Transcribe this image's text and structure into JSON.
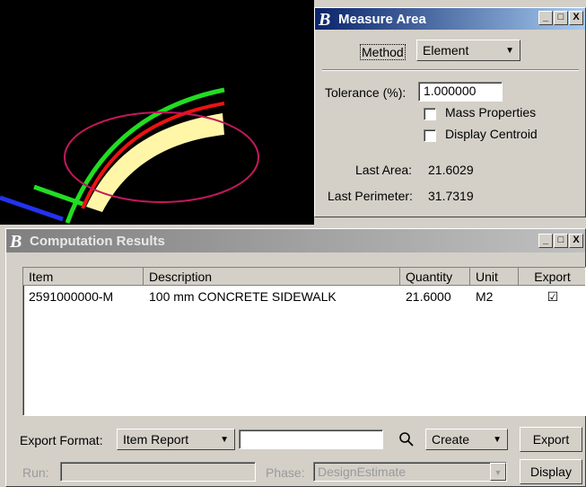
{
  "measure_area": {
    "title": "Measure Area",
    "method_label": "Method",
    "method_value": "Element",
    "tolerance_label": "Tolerance (%):",
    "tolerance_value": "1.000000",
    "mass_properties_label": "Mass Properties",
    "display_centroid_label": "Display Centroid",
    "last_area_label": "Last Area:",
    "last_area_value": "21.6029",
    "last_perimeter_label": "Last Perimeter:",
    "last_perimeter_value": "31.7319"
  },
  "computation_results": {
    "title": "Computation Results",
    "columns": {
      "item": "Item",
      "description": "Description",
      "quantity": "Quantity",
      "unit": "Unit",
      "export": "Export"
    },
    "rows": [
      {
        "item": "2591000000-M",
        "description": "100 mm CONCRETE SIDEWALK",
        "quantity": "21.6000",
        "unit": "M2",
        "export": "☑"
      }
    ],
    "export_format_label": "Export Format:",
    "export_format_value": "Item Report",
    "filter_value": "",
    "create_value": "Create",
    "export_button": "Export",
    "run_label": "Run:",
    "run_value": "",
    "phase_label": "Phase:",
    "phase_value": "DesignEstimate",
    "display_button": "Display"
  },
  "window_buttons": {
    "minimize": "_",
    "maximize": "□",
    "close": "X"
  },
  "colors": {
    "accent_title": "#0a246a",
    "viewport_bg": "#000000",
    "highlight_fill": "#fff6a8",
    "selection_ellipse": "#c2185b",
    "green_line": "#22dd22",
    "red_line": "#ee1111",
    "blue_line": "#2233ee"
  }
}
